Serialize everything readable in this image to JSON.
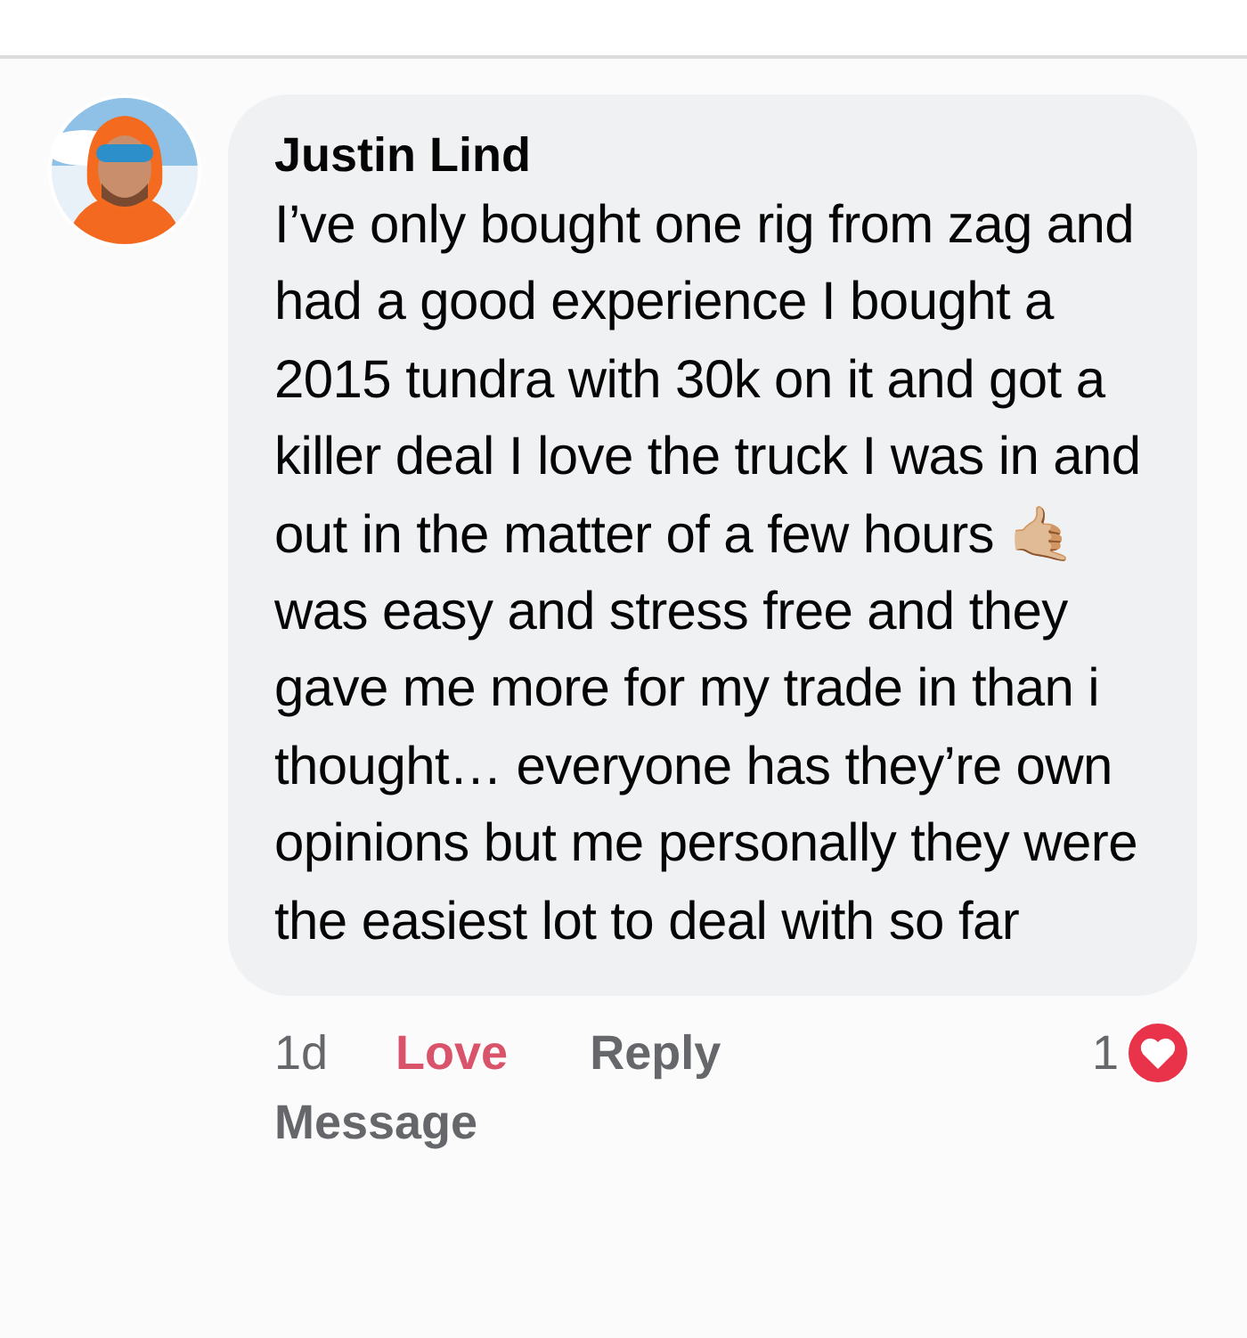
{
  "comment": {
    "author": "Justin Lind",
    "text": "I’ve only bought one rig from zag and had a good experience I bought a 2015 tundra with 30k on it and got a killer deal I love the truck I was in and out in the matter of a few hours 🤙🏼 was easy and stress free and they gave me more for my trade in than i thought… everyone has they’re own opinions but me personally they were the easiest lot to deal with so far"
  },
  "actions": {
    "time": "1d",
    "love": {
      "label": "Love",
      "selected": true
    },
    "reply": "Reply",
    "message": "Message",
    "reaction_count": "1"
  }
}
